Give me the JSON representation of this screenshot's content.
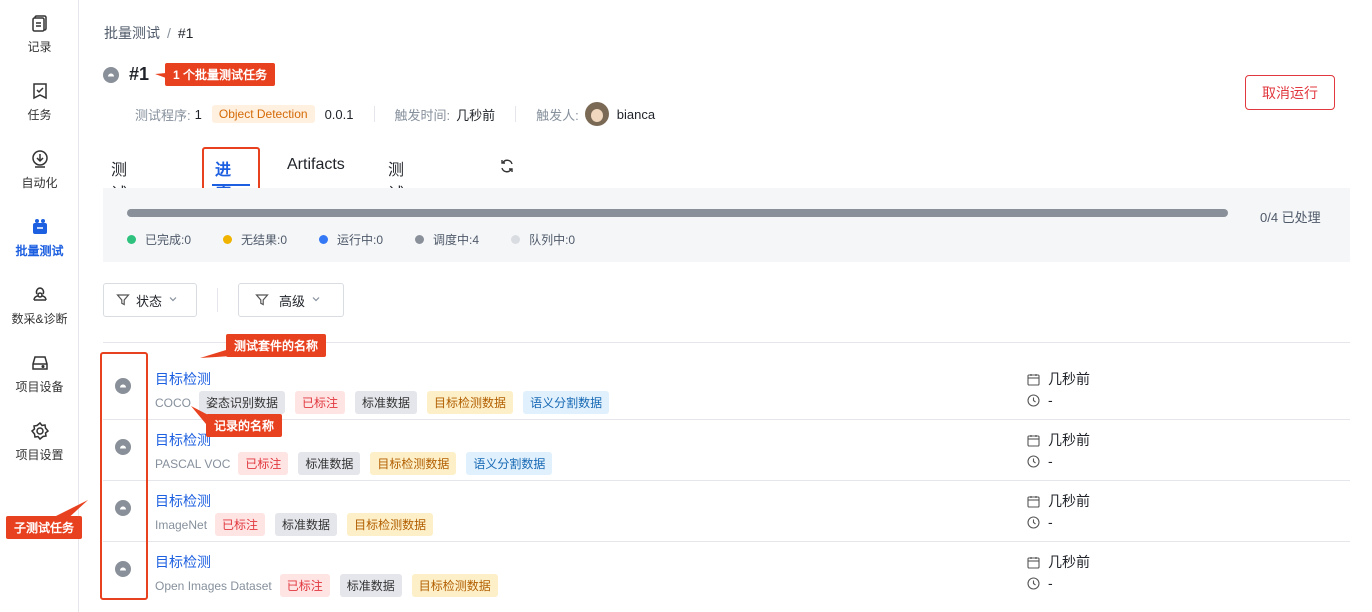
{
  "sidebar": {
    "items": [
      {
        "label": "记录",
        "icon": "clipboard-icon"
      },
      {
        "label": "任务",
        "icon": "task-icon"
      },
      {
        "label": "自动化",
        "icon": "automation-icon"
      },
      {
        "label": "批量测试",
        "icon": "batch-test-icon",
        "active": true
      },
      {
        "label": "数采&诊断",
        "icon": "diagnosis-icon"
      },
      {
        "label": "项目设备",
        "icon": "device-icon"
      },
      {
        "label": "项目设置",
        "icon": "gear-icon"
      }
    ]
  },
  "breadcrumb": {
    "parent": "批量测试",
    "separator": "/",
    "current": "#1"
  },
  "header": {
    "title": "#1",
    "meta": {
      "program_label": "测试程序:",
      "program_count": "1",
      "program_tag": "Object Detection",
      "program_version": "0.0.1",
      "trigger_time_label": "触发时间:",
      "trigger_time": "几秒前",
      "trigger_user_label": "触发人:",
      "trigger_user": "bianca"
    },
    "cancel_label": "取消运行"
  },
  "tabs": [
    {
      "label": "测试报告"
    },
    {
      "label": "进度",
      "active": true
    },
    {
      "label": "Artifacts"
    },
    {
      "label": "测试输出"
    }
  ],
  "progress": {
    "processed": 0,
    "total": 4,
    "summary": "0/4 已处理",
    "legend": [
      {
        "label": "已完成:0",
        "color": "#2ec27e"
      },
      {
        "label": "无结果:0",
        "color": "#f0b400"
      },
      {
        "label": "运行中:0",
        "color": "#3478f6"
      },
      {
        "label": "调度中:4",
        "color": "#8a9099"
      },
      {
        "label": "队列中:0",
        "color": "#d9dce1"
      }
    ]
  },
  "filters": {
    "status": "状态",
    "advanced": "高级"
  },
  "rows": [
    {
      "suite": "目标检测",
      "record": "COCO",
      "tags": [
        {
          "text": "姿态识别数据",
          "style": "gray"
        },
        {
          "text": "已标注",
          "style": "red"
        },
        {
          "text": "标准数据",
          "style": "gray"
        },
        {
          "text": "目标检测数据",
          "style": "yellow"
        },
        {
          "text": "语义分割数据",
          "style": "blue"
        }
      ],
      "created": "几秒前",
      "duration": "-"
    },
    {
      "suite": "目标检测",
      "record": "PASCAL VOC",
      "tags": [
        {
          "text": "已标注",
          "style": "red"
        },
        {
          "text": "标准数据",
          "style": "gray"
        },
        {
          "text": "目标检测数据",
          "style": "yellow"
        },
        {
          "text": "语义分割数据",
          "style": "blue"
        }
      ],
      "created": "几秒前",
      "duration": "-"
    },
    {
      "suite": "目标检测",
      "record": "ImageNet",
      "tags": [
        {
          "text": "已标注",
          "style": "red"
        },
        {
          "text": "标准数据",
          "style": "gray"
        },
        {
          "text": "目标检测数据",
          "style": "yellow"
        }
      ],
      "created": "几秒前",
      "duration": "-"
    },
    {
      "suite": "目标检测",
      "record": "Open Images Dataset",
      "tags": [
        {
          "text": "已标注",
          "style": "red"
        },
        {
          "text": "标准数据",
          "style": "gray"
        },
        {
          "text": "目标检测数据",
          "style": "yellow"
        }
      ],
      "created": "几秒前",
      "duration": "-"
    }
  ],
  "annotations": {
    "batch_task": "1 个批量测试任务",
    "suite_name": "测试套件的名称",
    "record_name": "记录的名称",
    "sub_task": "子测试任务"
  },
  "colors": {
    "accent": "#1c5fe0",
    "danger": "#e0383e",
    "annotation": "#e8411f"
  }
}
